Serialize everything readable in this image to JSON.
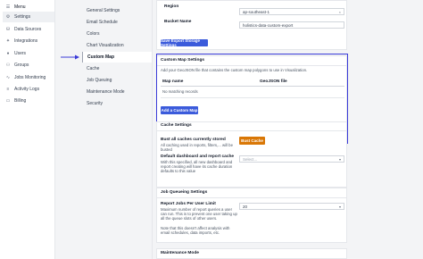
{
  "leftnav": {
    "menu_label": "Menu",
    "items": [
      {
        "label": "Settings",
        "icon": "gear-icon"
      },
      {
        "label": "Data Sources",
        "icon": "database-icon"
      },
      {
        "label": "Integrations",
        "icon": "puzzle-icon"
      },
      {
        "label": "Users",
        "icon": "user-icon"
      },
      {
        "label": "Groups",
        "icon": "group-icon"
      },
      {
        "label": "Jobs Monitoring",
        "icon": "pulse-icon"
      },
      {
        "label": "Activity Logs",
        "icon": "log-icon"
      },
      {
        "label": "Billing",
        "icon": "card-icon"
      }
    ]
  },
  "subnav": {
    "items": [
      "General Settings",
      "Email Schedule",
      "Colors",
      "Chart Visualization",
      "Custom Map",
      "Cache",
      "Job Queuing",
      "Maintenance Mode",
      "Security"
    ]
  },
  "export": {
    "region_label": "Region",
    "region_value": "ap-southeast-1",
    "bucket_label": "Bucket Name",
    "bucket_value": "holistics-data-custom-export",
    "save_button": "Save Export Storage Settings"
  },
  "custom_map": {
    "title": "Custom Map Settings",
    "description": "Add your GeoJSON file that contains the custom map polygons to use in Visualization.",
    "col_map_name": "Map name",
    "col_geojson": "GeoJSON file",
    "empty_text": "No matching records",
    "add_button": "Add a Custom Map"
  },
  "cache": {
    "title": "Cache Settings",
    "bust_label": "Bust all caches currently stored",
    "bust_desc": "All caching used in reports, filters,... will be busted",
    "bust_button": "Bust Cache",
    "default_label": "Default dashboard and report cache",
    "default_desc": "With this specified, all new dashboard and report creating will have its cache duration defaults to this value",
    "default_placeholder": "Select..."
  },
  "job_queuing": {
    "title": "Job Queueing Settings",
    "limit_label": "Report Jobs Per User Limit",
    "limit_desc": "Maximum number of report queries a user can run. This is to prevent one user taking up all the queue slots of other users.",
    "limit_note": "Note that this doesn't affect analysis with email schedules, data imports, etc.",
    "limit_value": "20"
  },
  "maintenance": {
    "title": "Maintenance Mode"
  }
}
